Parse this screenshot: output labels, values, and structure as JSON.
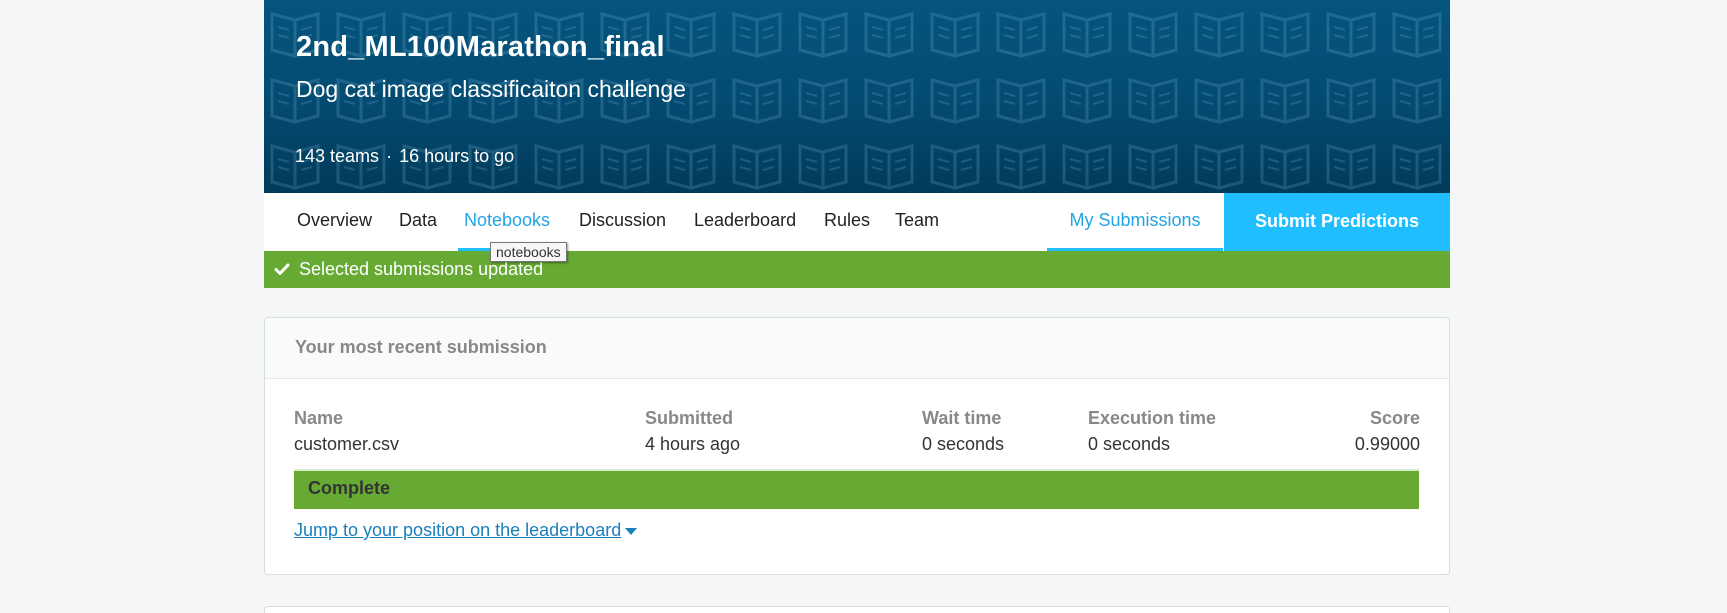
{
  "header": {
    "title": "2nd_ML100Marathon_final",
    "subtitle": "Dog cat image classificaiton challenge",
    "teams": "143 teams",
    "separator": "·",
    "time_left": "16 hours to go"
  },
  "nav": {
    "tabs": [
      "Overview",
      "Data",
      "Notebooks",
      "Discussion",
      "Leaderboard",
      "Rules",
      "Team"
    ],
    "active_tab": "Notebooks",
    "my_submissions": "My Submissions",
    "submit_predictions": "Submit Predictions",
    "tooltip": "notebooks"
  },
  "alert": {
    "message": "Selected submissions updated",
    "color": "#66aa33"
  },
  "submission": {
    "heading": "Your most recent submission",
    "columns": {
      "name_label": "Name",
      "name_value": "customer.csv",
      "submitted_label": "Submitted",
      "submitted_value": "4 hours ago",
      "wait_label": "Wait time",
      "wait_value": "0 seconds",
      "exec_label": "Execution time",
      "exec_value": "0 seconds",
      "score_label": "Score",
      "score_value": "0.99000"
    },
    "status": "Complete",
    "jump_link": "Jump to your position on the leaderboard"
  },
  "colors": {
    "header_bg": "#04557f",
    "accent": "#20beff",
    "success": "#66aa33"
  },
  "icons": [
    "check-icon",
    "caret-down-icon",
    "book-pattern"
  ]
}
